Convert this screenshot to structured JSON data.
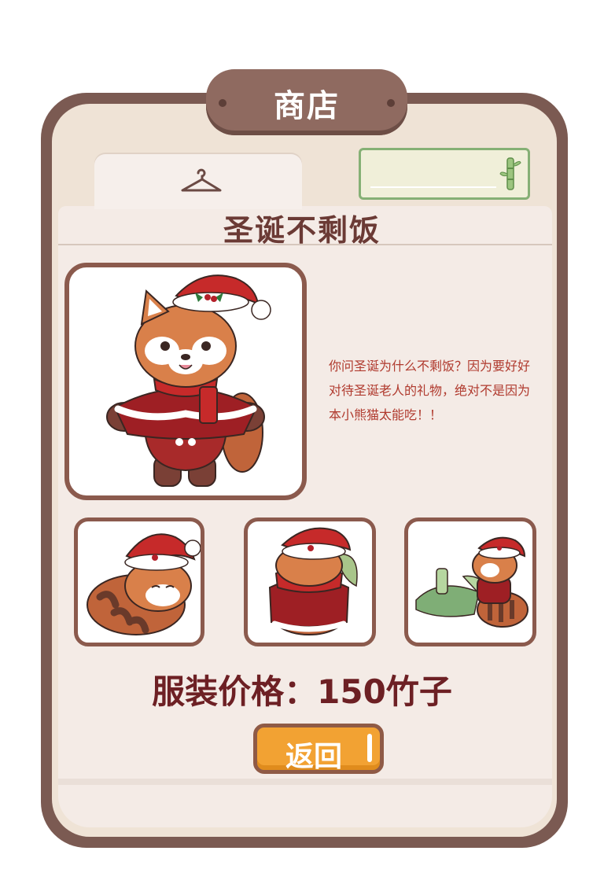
{
  "header": {
    "title": "商店"
  },
  "tabs": [
    {
      "icon": "hanger-icon"
    }
  ],
  "currency": {
    "icon": "bamboo-icon",
    "value": ""
  },
  "outfit": {
    "title": "圣诞不剩饭",
    "description": "你问圣诞为什么不剩饭？因为要好好对待圣诞老人的礼物，绝对不是因为本小熊猫太能吃！！"
  },
  "price": {
    "text": "服装价格：150竹子"
  },
  "buttons": {
    "back": "返回"
  },
  "colors": {
    "frame": "#7b5a52",
    "header": "#8f6a60",
    "title": "#6b3a35",
    "description": "#b03a2e",
    "price": "#6d2024",
    "button": "#f2a233",
    "currency_border": "#85b075"
  }
}
